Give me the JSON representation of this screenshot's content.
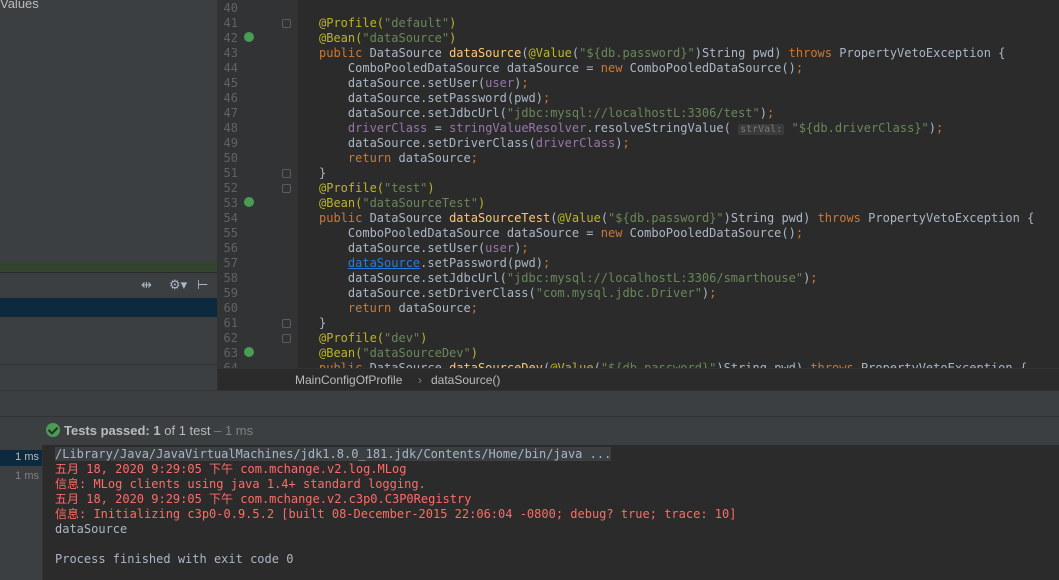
{
  "left_panel": {
    "title": "Values"
  },
  "editor": {
    "lines": [
      {
        "n": "40",
        "html": ""
      },
      {
        "n": "41",
        "html": "<span class='ann'>@Profile(</span><span class='str'>\"default\"</span><span class='ann'>)</span>",
        "fold": true
      },
      {
        "n": "42",
        "html": "<span class='ann'>@Bean(</span><span class='str'>\"dataSource\"</span><span class='ann'>)</span>",
        "icon": true
      },
      {
        "n": "43",
        "html": "<span class='kw'>public</span> DataSource <span class='fn'>dataSource</span>(<span class='ann'>@Value</span>(<span class='str'>\"${db.password}\"</span>)String pwd) <span class='kw'>throws</span> PropertyVetoException {"
      },
      {
        "n": "44",
        "html": "    ComboPooledDataSource dataSource = <span class='kw'>new</span> ComboPooledDataSource()<span class='kw'>;</span>"
      },
      {
        "n": "45",
        "html": "    dataSource.setUser(<span class='fld'>user</span>)<span class='kw'>;</span>"
      },
      {
        "n": "46",
        "html": "    dataSource.setPassword(pwd)<span class='kw'>;</span>"
      },
      {
        "n": "47",
        "html": "    dataSource.setJdbcUrl(<span class='str'>\"jdbc:mysql://localhostL:3306/test\"</span>)<span class='kw'>;</span>"
      },
      {
        "n": "48",
        "html": "    <span class='fld'>driverClass</span> = <span class='fld'>stringValueResolver</span>.resolveStringValue( <span class='hint'>strVal:</span> <span class='str'>\"${db.driverClass}\"</span>)<span class='kw'>;</span>"
      },
      {
        "n": "49",
        "html": "    dataSource.setDriverClass(<span class='fld'>driverClass</span>)<span class='kw'>;</span>"
      },
      {
        "n": "50",
        "html": "    <span class='kw'>return</span> dataSource<span class='kw'>;</span>"
      },
      {
        "n": "51",
        "html": "}",
        "fold": true
      },
      {
        "n": "52",
        "html": "<span class='ann'>@Profile(</span><span class='str'>\"test\"</span><span class='ann'>)</span>",
        "fold": true
      },
      {
        "n": "53",
        "html": "<span class='ann'>@Bean(</span><span class='str'>\"dataSourceTest\"</span><span class='ann'>)</span>",
        "icon": true
      },
      {
        "n": "54",
        "html": "<span class='kw'>public</span> DataSource <span class='fn'>dataSourceTest</span>(<span class='ann'>@Value</span>(<span class='str'>\"${db.password}\"</span>)String pwd) <span class='kw'>throws</span> PropertyVetoException {"
      },
      {
        "n": "55",
        "html": "    ComboPooledDataSource dataSource = <span class='kw'>new</span> ComboPooledDataSource()<span class='kw'>;</span>"
      },
      {
        "n": "56",
        "html": "    dataSource.setUser(<span class='fld'>user</span>)<span class='kw'>;</span>"
      },
      {
        "n": "57",
        "html": "    <span class='link'>dataSource</span>.setPassword(pwd)<span class='kw'>;</span>"
      },
      {
        "n": "58",
        "html": "    dataSource.setJdbcUrl(<span class='str'>\"jdbc:mysql://localhostL:3306/smarthouse\"</span>)<span class='kw'>;</span>"
      },
      {
        "n": "59",
        "html": "    dataSource.setDriverClass(<span class='str'>\"com.mysql.jdbc.Driver\"</span>)<span class='kw'>;</span>"
      },
      {
        "n": "60",
        "html": "    <span class='kw'>return</span> dataSource<span class='kw'>;</span>"
      },
      {
        "n": "61",
        "html": "}",
        "fold": true
      },
      {
        "n": "62",
        "html": "<span class='ann'>@Profile(</span><span class='str'>\"dev\"</span><span class='ann'>)</span>",
        "fold": true
      },
      {
        "n": "63",
        "html": "<span class='ann'>@Bean(</span><span class='str'>\"dataSourceDev\"</span><span class='ann'>)</span>",
        "icon": true
      },
      {
        "n": "64",
        "html": "<span class='kw'>public</span> DataSource <span class='fn'>dataSourceDev</span>(<span class='ann'>@Value</span>(<span class='str'>\"${db.password}\"</span>)String pwd) <span class='kw'>throws</span> PropertyVetoException {"
      }
    ]
  },
  "breadcrumb": {
    "class_name": "MainConfigOfProfile",
    "separator": "›",
    "method_name": "dataSource()"
  },
  "tests": {
    "status_label": "Tests passed:",
    "passed": "1",
    "of_label": "of 1 test",
    "duration": "– 1 ms"
  },
  "run_tree": {
    "timings": [
      "1 ms",
      "1 ms"
    ]
  },
  "console": {
    "command": "/Library/Java/JavaVirtualMachines/jdk1.8.0_181.jdk/Contents/Home/bin/java ...",
    "log1": "五月 18, 2020 9:29:05 下午 com.mchange.v2.log.MLog",
    "log2": "信息: MLog clients using java 1.4+ standard logging.",
    "log3": "五月 18, 2020 9:29:05 下午 com.mchange.v2.c3p0.C3P0Registry",
    "log4": "信息: Initializing c3p0-0.9.5.2 [built 08-December-2015 22:06:04 -0800; debug? true; trace: 10]",
    "output": "dataSource",
    "exit": "Process finished with exit code 0"
  },
  "colors": {
    "accent_green": "#499c54",
    "error_red": "#ff6b68",
    "selection": "#0d293e"
  }
}
